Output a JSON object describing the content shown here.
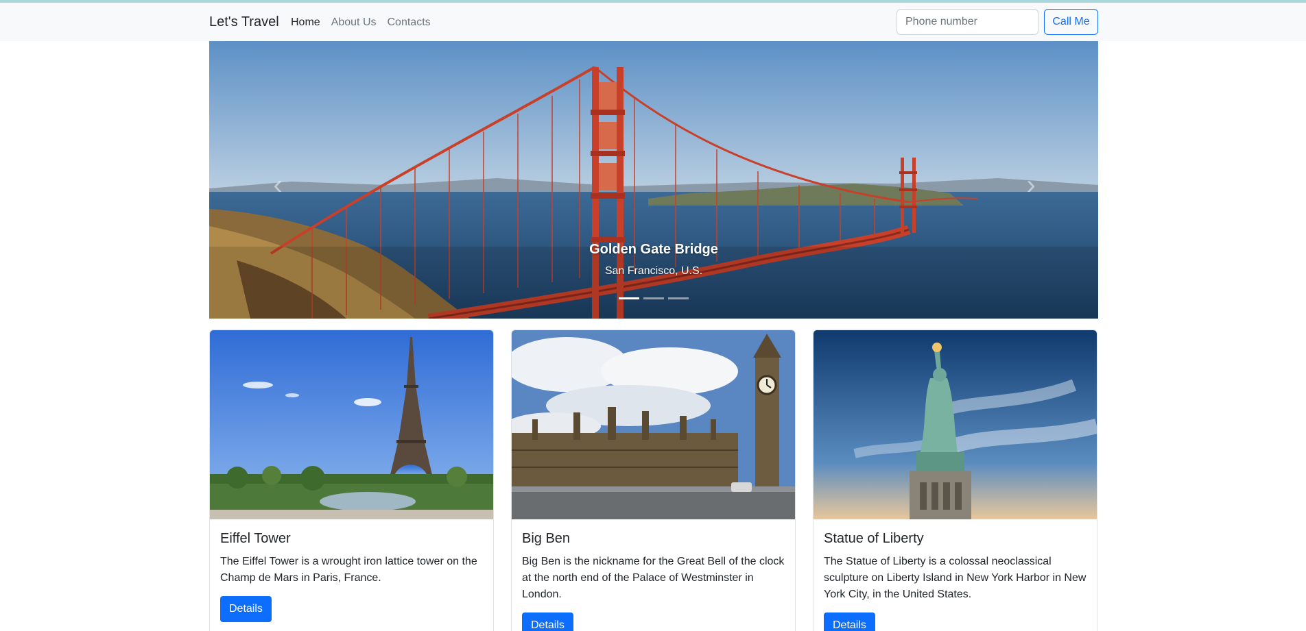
{
  "navbar": {
    "brand": "Let's Travel",
    "links": [
      {
        "label": "Home",
        "active": true
      },
      {
        "label": "About Us",
        "active": false
      },
      {
        "label": "Contacts",
        "active": false
      }
    ],
    "phone_placeholder": "Phone number",
    "call_label": "Call Me"
  },
  "carousel": {
    "title": "Golden Gate Bridge",
    "subtitle": "San Francisco, U.S.",
    "prev_icon": "chevron-left-icon",
    "next_icon": "chevron-right-icon",
    "slide_count": 3,
    "active_index": 0
  },
  "cards": [
    {
      "title": "Eiffel Tower",
      "text": "The Eiffel Tower is a wrought iron lattice tower on the Champ de Mars in Paris, France.",
      "button": "Details"
    },
    {
      "title": "Big Ben",
      "text": "Big Ben is the nickname for the Great Bell of the clock at the north end of the Palace of Westminster in London.",
      "button": "Details"
    },
    {
      "title": "Statue of Liberty",
      "text": "The Statue of Liberty is a colossal neoclassical sculpture on Liberty Island in New York Harbor in New York City, in the United States.",
      "button": "Details"
    }
  ],
  "colors": {
    "primary": "#0d6efd",
    "navbar_bg": "#f8f9fa",
    "bridge": "#c8402a"
  }
}
